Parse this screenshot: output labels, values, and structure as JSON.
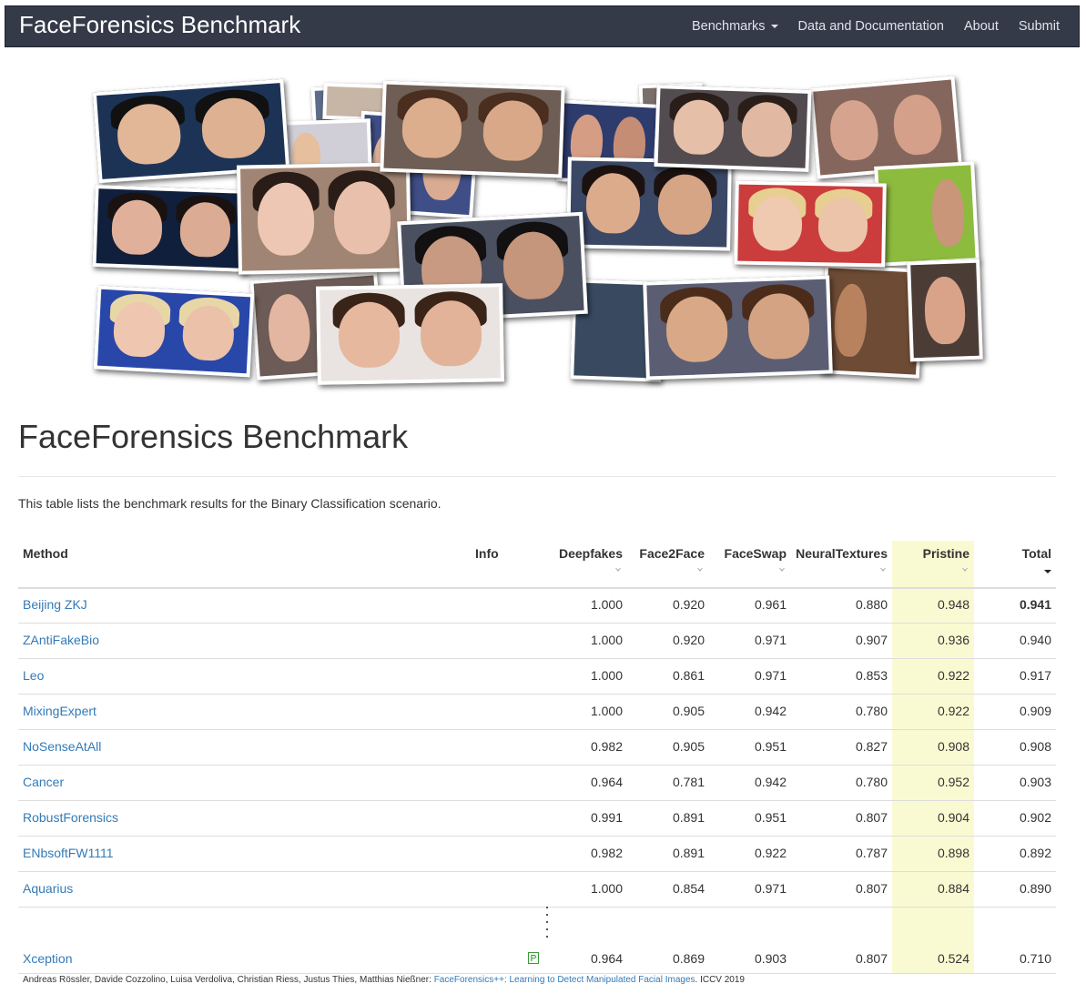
{
  "navbar": {
    "brand": "FaceForensics Benchmark",
    "links": [
      {
        "label": "Benchmarks",
        "has_caret": true
      },
      {
        "label": "Data and Documentation"
      },
      {
        "label": "About"
      },
      {
        "label": "Submit"
      }
    ]
  },
  "page": {
    "title": "FaceForensics Benchmark",
    "intro": "This table lists the benchmark results for the Binary Classification scenario."
  },
  "table": {
    "columns": [
      "Method",
      "Info",
      "Deepfakes",
      "Face2Face",
      "FaceSwap",
      "NeuralTextures",
      "Pristine",
      "Total"
    ],
    "highlight_column": "Pristine",
    "sorted_column": "Total",
    "rows": [
      {
        "method": "Beijing ZKJ",
        "info": "",
        "values": [
          "1.000",
          "0.920",
          "0.961",
          "0.880",
          "0.948",
          "0.941"
        ],
        "total_bold": true
      },
      {
        "method": "ZAntiFakeBio",
        "info": "",
        "values": [
          "1.000",
          "0.920",
          "0.971",
          "0.907",
          "0.936",
          "0.940"
        ]
      },
      {
        "method": "Leo",
        "info": "",
        "values": [
          "1.000",
          "0.861",
          "0.971",
          "0.853",
          "0.922",
          "0.917"
        ]
      },
      {
        "method": "MixingExpert",
        "info": "",
        "values": [
          "1.000",
          "0.905",
          "0.942",
          "0.780",
          "0.922",
          "0.909"
        ]
      },
      {
        "method": "NoSenseAtAll",
        "info": "",
        "values": [
          "0.982",
          "0.905",
          "0.951",
          "0.827",
          "0.908",
          "0.908"
        ]
      },
      {
        "method": "Cancer",
        "info": "",
        "values": [
          "0.964",
          "0.781",
          "0.942",
          "0.780",
          "0.952",
          "0.903"
        ]
      },
      {
        "method": "RobustForensics",
        "info": "",
        "values": [
          "0.991",
          "0.891",
          "0.951",
          "0.807",
          "0.904",
          "0.902"
        ]
      },
      {
        "method": "ENbsoftFW1111",
        "info": "",
        "values": [
          "0.982",
          "0.891",
          "0.922",
          "0.787",
          "0.898",
          "0.892"
        ]
      },
      {
        "method": "Aquarius",
        "info": "",
        "values": [
          "1.000",
          "0.854",
          "0.971",
          "0.807",
          "0.884",
          "0.890"
        ]
      }
    ],
    "last_row": {
      "method": "Xception",
      "info_badge": "P",
      "values": [
        "0.964",
        "0.869",
        "0.903",
        "0.807",
        "0.524",
        "0.710"
      ]
    }
  },
  "citation": {
    "authors": "Andreas Rössler, Davide Cozzolino, Luisa Verdoliva, Christian Riess, Justus Thies, Matthias Nießner: ",
    "paper": "FaceForensics++: Learning to Detect Manipulated Facial Images",
    "venue": ". ICCV 2019"
  },
  "colors": {
    "navbar_bg": "#343a48",
    "link": "#337ab7",
    "highlight": "#fafad2"
  }
}
